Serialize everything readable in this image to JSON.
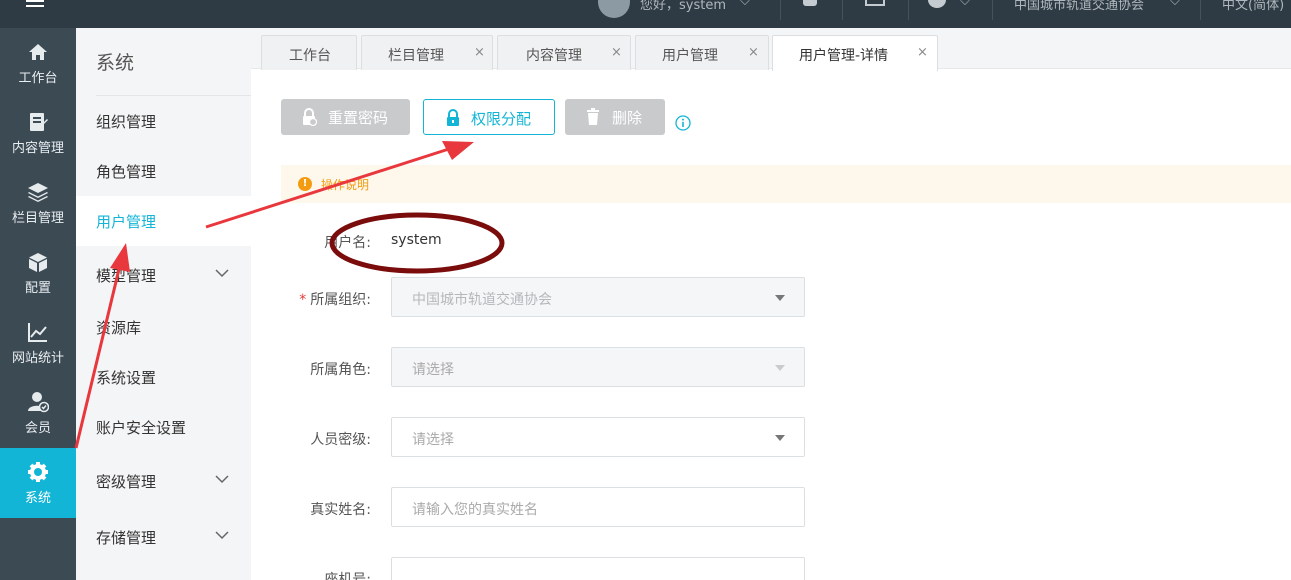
{
  "topbar": {
    "greeting": "您好，system",
    "org": "中国城市轨道交通协会",
    "language": "中文(简体)"
  },
  "iconbar": {
    "items": [
      {
        "label": "工作台",
        "icon": "home-icon"
      },
      {
        "label": "内容管理",
        "icon": "document-edit-icon"
      },
      {
        "label": "栏目管理",
        "icon": "layers-icon"
      },
      {
        "label": "配置",
        "icon": "cube-icon"
      },
      {
        "label": "网站统计",
        "icon": "line-chart-icon"
      },
      {
        "label": "会员",
        "icon": "user-check-icon"
      },
      {
        "label": "系统",
        "icon": "gear-icon"
      }
    ],
    "active_color": "#13b5d6"
  },
  "menubar": {
    "title": "系统",
    "items": [
      {
        "label": "组织管理"
      },
      {
        "label": "角色管理"
      },
      {
        "label": "用户管理"
      },
      {
        "label": "模型管理"
      },
      {
        "label": "资源库"
      },
      {
        "label": "系统设置"
      },
      {
        "label": "账户安全设置"
      },
      {
        "label": "密级管理"
      },
      {
        "label": "存储管理"
      }
    ]
  },
  "tabs": [
    {
      "label": "工作台",
      "closable": false
    },
    {
      "label": "栏目管理",
      "closable": true
    },
    {
      "label": "内容管理",
      "closable": true
    },
    {
      "label": "用户管理",
      "closable": true
    },
    {
      "label": "用户管理-详情",
      "closable": true
    }
  ],
  "tab_close": "×",
  "actions": {
    "reset_password": "重置密码",
    "assign_permissions": "权限分配",
    "delete": "删除"
  },
  "notice": {
    "text": "操作说明"
  },
  "form": {
    "username_label": "用户名:",
    "username_value": "system",
    "org_label": "所属组织:",
    "org_value": "中国城市轨道交通协会",
    "role_label": "所属角色:",
    "role_placeholder": "请选择",
    "clearance_label": "人员密级:",
    "clearance_placeholder": "请选择",
    "realname_label": "真实姓名:",
    "realname_placeholder": "请输入您的真实姓名",
    "phone_label": "座机号:"
  },
  "annotation_color": "#e8373d",
  "circle_color": "#7a0c0c"
}
